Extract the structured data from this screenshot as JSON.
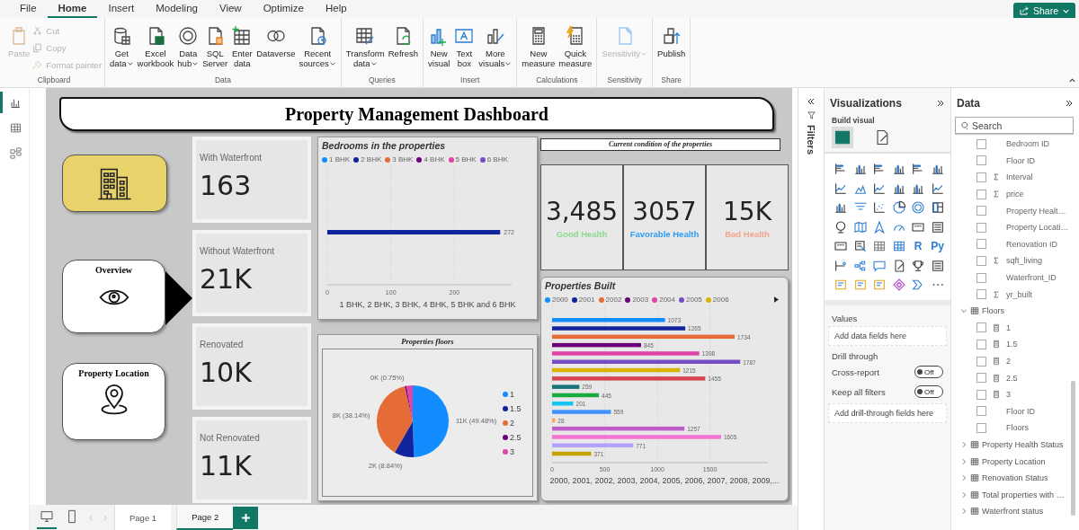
{
  "menu_tabs": [
    {
      "label": "File",
      "selected": false
    },
    {
      "label": "Home",
      "selected": true
    },
    {
      "label": "Insert",
      "selected": false
    },
    {
      "label": "Modeling",
      "selected": false
    },
    {
      "label": "View",
      "selected": false
    },
    {
      "label": "Optimize",
      "selected": false
    },
    {
      "label": "Help",
      "selected": false
    }
  ],
  "share_button": {
    "label": "Share"
  },
  "ribbon_groups": [
    {
      "label": "Clipboard",
      "buttons": [
        {
          "kind": "large",
          "lines": [
            "Paste"
          ],
          "disabled": true,
          "dropdown": false
        },
        {
          "kind": "small",
          "lines": [
            "Cut"
          ],
          "disabled": true,
          "dropdown": false
        },
        {
          "kind": "small",
          "lines": [
            "Copy"
          ],
          "disabled": true,
          "dropdown": false
        },
        {
          "kind": "small",
          "lines": [
            "Format painter"
          ],
          "disabled": true,
          "dropdown": false
        }
      ]
    },
    {
      "label": "Data",
      "buttons": [
        {
          "kind": "large",
          "lines": [
            "Get",
            "data"
          ],
          "disabled": false,
          "dropdown": true
        },
        {
          "kind": "large",
          "lines": [
            "Excel",
            "workbook"
          ],
          "disabled": false,
          "dropdown": false
        },
        {
          "kind": "large",
          "lines": [
            "Data",
            "hub"
          ],
          "disabled": false,
          "dropdown": true
        },
        {
          "kind": "large",
          "lines": [
            "SQL",
            "Server"
          ],
          "disabled": false,
          "dropdown": false
        },
        {
          "kind": "large",
          "lines": [
            "Enter",
            "data"
          ],
          "disabled": false,
          "dropdown": false
        },
        {
          "kind": "large",
          "lines": [
            "Dataverse"
          ],
          "disabled": false,
          "dropdown": false
        },
        {
          "kind": "large",
          "lines": [
            "Recent",
            "sources"
          ],
          "disabled": false,
          "dropdown": true
        }
      ]
    },
    {
      "label": "Queries",
      "buttons": [
        {
          "kind": "large",
          "lines": [
            "Transform",
            "data"
          ],
          "disabled": false,
          "dropdown": true
        },
        {
          "kind": "large",
          "lines": [
            "Refresh"
          ],
          "disabled": false,
          "dropdown": false
        }
      ]
    },
    {
      "label": "Insert",
      "buttons": [
        {
          "kind": "large",
          "lines": [
            "New",
            "visual"
          ],
          "disabled": false,
          "dropdown": false
        },
        {
          "kind": "large",
          "lines": [
            "Text",
            "box"
          ],
          "disabled": false,
          "dropdown": false
        },
        {
          "kind": "large",
          "lines": [
            "More",
            "visuals"
          ],
          "disabled": false,
          "dropdown": true
        }
      ]
    },
    {
      "label": "Calculations",
      "buttons": [
        {
          "kind": "large",
          "lines": [
            "New",
            "measure"
          ],
          "disabled": false,
          "dropdown": false
        },
        {
          "kind": "large",
          "lines": [
            "Quick",
            "measure"
          ],
          "disabled": false,
          "dropdown": false
        }
      ]
    },
    {
      "label": "Sensitivity",
      "buttons": [
        {
          "kind": "large",
          "lines": [
            "Sensitivity"
          ],
          "disabled": true,
          "dropdown": true
        }
      ]
    },
    {
      "label": "Share",
      "buttons": [
        {
          "kind": "large",
          "lines": [
            "Publish"
          ],
          "disabled": false,
          "dropdown": false
        }
      ]
    }
  ],
  "view_rail": [
    {
      "selected": true
    },
    {
      "selected": false
    },
    {
      "selected": false
    }
  ],
  "report": {
    "title": "Property Management Dashboard",
    "nav_buttons": [
      {
        "label": "Overview",
        "selected": true
      },
      {
        "label": "Property Location",
        "selected": false
      }
    ],
    "kpi_cards": [
      {
        "label": "With Waterfront",
        "value": "163"
      },
      {
        "label": "Without Waterfront",
        "value": "21K"
      },
      {
        "label": "Renovated",
        "value": "10K"
      },
      {
        "label": "Not Renovated",
        "value": "11K"
      }
    ],
    "bedrooms_chart": {
      "chart_data": {
        "type": "bar",
        "orientation": "horizontal",
        "title": "Bedrooms in the properties",
        "xlabel": "1 BHK, 2 BHK, 3 BHK, 4 BHK, 5 BHK and 6 BHK",
        "xlim": [
          0,
          290
        ],
        "xticks": [
          0,
          100,
          200
        ],
        "grid": true,
        "data_labels": true,
        "series": [
          {
            "name": "1 BHK",
            "color": "#118dff",
            "values": [
              null
            ]
          },
          {
            "name": "2 BHK",
            "color": "#12239e",
            "values": [
              272
            ]
          },
          {
            "name": "3 BHK",
            "color": "#e66c37",
            "values": [
              null
            ]
          },
          {
            "name": "4 BHK",
            "color": "#6b007b",
            "values": [
              null
            ]
          },
          {
            "name": "5 BHK",
            "color": "#e044a7",
            "values": [
              null
            ]
          },
          {
            "name": "6 BHK",
            "color": "#744ec2",
            "values": [
              null
            ]
          }
        ]
      }
    },
    "floors_chart": {
      "chart_data": {
        "type": "pie",
        "title": "Properties floors",
        "categories": [
          "1",
          "1.5",
          "2",
          "2.5",
          "3"
        ],
        "values": [
          49.48,
          8.84,
          38.14,
          0.75,
          2.79
        ],
        "colors": [
          "#118dff",
          "#12239e",
          "#e66c37",
          "#6b007b",
          "#e044a7"
        ],
        "value_labels": [
          "11K (49.48%)",
          "2K (8.84%)",
          "8K (38.14%)",
          "0K (0.75%)",
          null
        ]
      }
    },
    "condition_title": "Current condition of the properties",
    "health_cards": [
      {
        "value": "3,485",
        "label": "Good Health",
        "color": "#8fd88f"
      },
      {
        "value": "3057",
        "label": "Favorable Health",
        "color": "#2f9cf2"
      },
      {
        "value": "15K",
        "label": "Bad Health",
        "color": "#f2a48e"
      }
    ],
    "built_chart": {
      "chart_data": {
        "type": "bar",
        "orientation": "horizontal",
        "title": "Properties Built",
        "xlabel": "2000, 2001, 2002, 2003, 2004, 2005, 2006, 2007, 2008, 2009,...",
        "xlim": [
          0,
          2050
        ],
        "xticks": [
          0,
          500,
          1000,
          1500
        ],
        "grid": true,
        "data_labels": true,
        "series": [
          {
            "name": "2000",
            "color": "#118dff",
            "values": [
              1073
            ]
          },
          {
            "name": "2001",
            "color": "#12239e",
            "values": [
              1265
            ]
          },
          {
            "name": "2002",
            "color": "#e66c37",
            "values": [
              1734
            ]
          },
          {
            "name": "2003",
            "color": "#6b007b",
            "values": [
              845
            ]
          },
          {
            "name": "2004",
            "color": "#e044a7",
            "values": [
              1398
            ]
          },
          {
            "name": "2005",
            "color": "#744ec2",
            "values": [
              1787
            ]
          },
          {
            "name": "2006",
            "color": "#d9b300",
            "values": [
              1215
            ]
          },
          {
            "color": "#d64550",
            "values": [
              1455
            ]
          },
          {
            "color": "#197278",
            "values": [
              259
            ]
          },
          {
            "color": "#1aab40",
            "values": [
              445
            ]
          },
          {
            "color": "#15c6f4",
            "values": [
              201
            ]
          },
          {
            "color": "#4092ff",
            "values": [
              559
            ]
          },
          {
            "color": "#ffa058",
            "values": [
              28
            ]
          },
          {
            "color": "#be5dc9",
            "values": [
              1257
            ]
          },
          {
            "color": "#f472d0",
            "values": [
              1605
            ]
          },
          {
            "color": "#b5a1ff",
            "values": [
              771
            ]
          },
          {
            "color": "#c4a200",
            "values": [
              371
            ]
          }
        ]
      }
    }
  },
  "pages": [
    {
      "label": "Page 1",
      "selected": false
    },
    {
      "label": "Page 2",
      "selected": true
    }
  ],
  "view_modes": [
    {
      "selected": true
    },
    {
      "selected": false
    }
  ],
  "filters_pane": {
    "label": "Filters"
  },
  "viz_pane": {
    "title": "Visualizations",
    "build_label": "Build visual",
    "build_tabs": [
      {
        "selected": true
      },
      {
        "selected": false
      }
    ],
    "script_visuals": [
      "R",
      "Py"
    ],
    "values_label": "Values",
    "values_placeholder": "Add data fields here",
    "drill_label": "Drill through",
    "toggles": [
      {
        "label": "Cross-report",
        "on": false,
        "state_text": "Off"
      },
      {
        "label": "Keep all filters",
        "on": false,
        "state_text": "Off"
      }
    ],
    "drill_placeholder": "Add drill-through fields here"
  },
  "data_pane": {
    "title": "Data",
    "search_placeholder": "Search",
    "fields": [
      {
        "label": "Bedroom ID",
        "kind": "column",
        "checked": false
      },
      {
        "label": "Floor ID",
        "kind": "column",
        "checked": false
      },
      {
        "label": "Interval",
        "kind": "sum",
        "checked": false
      },
      {
        "label": "price",
        "kind": "sum",
        "checked": false
      },
      {
        "label": "Property Healt…",
        "kind": "column",
        "checked": false
      },
      {
        "label": "Property Locati…",
        "kind": "column",
        "checked": false
      },
      {
        "label": "Renovation ID",
        "kind": "column",
        "checked": false
      },
      {
        "label": "sqft_living",
        "kind": "sum",
        "checked": false
      },
      {
        "label": "Waterfront_ID",
        "kind": "column",
        "checked": false
      },
      {
        "label": "yr_built",
        "kind": "sum",
        "checked": false
      }
    ],
    "tables": [
      {
        "label": "Floors",
        "expanded": true,
        "children": [
          {
            "label": "1",
            "kind": "measure",
            "checked": false
          },
          {
            "label": "1.5",
            "kind": "measure",
            "checked": false
          },
          {
            "label": "2",
            "kind": "measure",
            "checked": false
          },
          {
            "label": "2.5",
            "kind": "measure",
            "checked": false
          },
          {
            "label": "3",
            "kind": "measure",
            "checked": false
          },
          {
            "label": "Floor ID",
            "kind": "column",
            "checked": false
          },
          {
            "label": "Floors",
            "kind": "column",
            "checked": false
          }
        ]
      },
      {
        "label": "Property Health Status",
        "expanded": false
      },
      {
        "label": "Property Location",
        "expanded": false
      },
      {
        "label": "Renovation Status",
        "expanded": false
      },
      {
        "label": "Total properties with …",
        "expanded": false
      },
      {
        "label": "Waterfront status",
        "expanded": false
      }
    ]
  }
}
